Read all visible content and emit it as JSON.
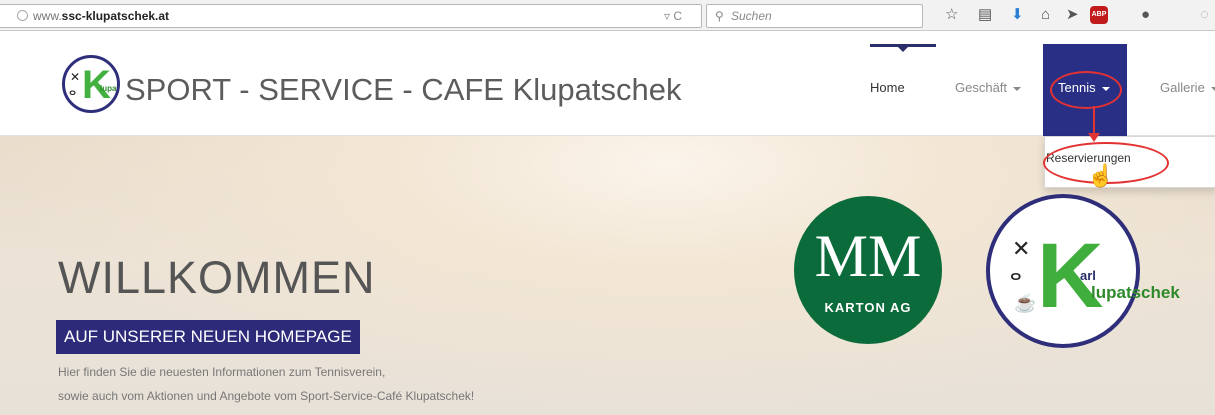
{
  "browser": {
    "url_prefix": "www.",
    "url_domain": "ssc-klupatschek.at",
    "url_tools": "▿ C",
    "search_placeholder": "Suchen",
    "toolbar": {
      "star": "☆",
      "reader": "▤",
      "download": "⬇",
      "home": "⌂",
      "send": "➤",
      "abp": "ABP",
      "chat": "●",
      "extra": "◌"
    }
  },
  "site": {
    "title": "SPORT - SERVICE - CAFE Klupatschek",
    "nav": {
      "home": "Home",
      "geschaeft": "Geschäft",
      "tennis": "Tennis",
      "gallerie": "Gallerie"
    },
    "dropdown": {
      "reservierungen": "Reservierungen"
    }
  },
  "hero": {
    "welcome": "WILLKOMMEN",
    "subtitle": "AUF UNSERER NEUEN HOMEPAGE",
    "line1": "Hier finden Sie die neuesten Informationen zum Tennisverein,",
    "line2": "sowie auch vom Aktionen und Angebote vom Sport-Service-Café Klupatschek!"
  },
  "logos": {
    "mm_big": "MM",
    "mm_small": "KARTON AG",
    "karl": "arl",
    "klupatschek": "lupatschek",
    "k": "K"
  },
  "colors": {
    "brand_navy": "#2a2f86",
    "brand_green": "#3fae3c",
    "mm_green": "#0b6b3a",
    "annotation_red": "#e23232"
  }
}
